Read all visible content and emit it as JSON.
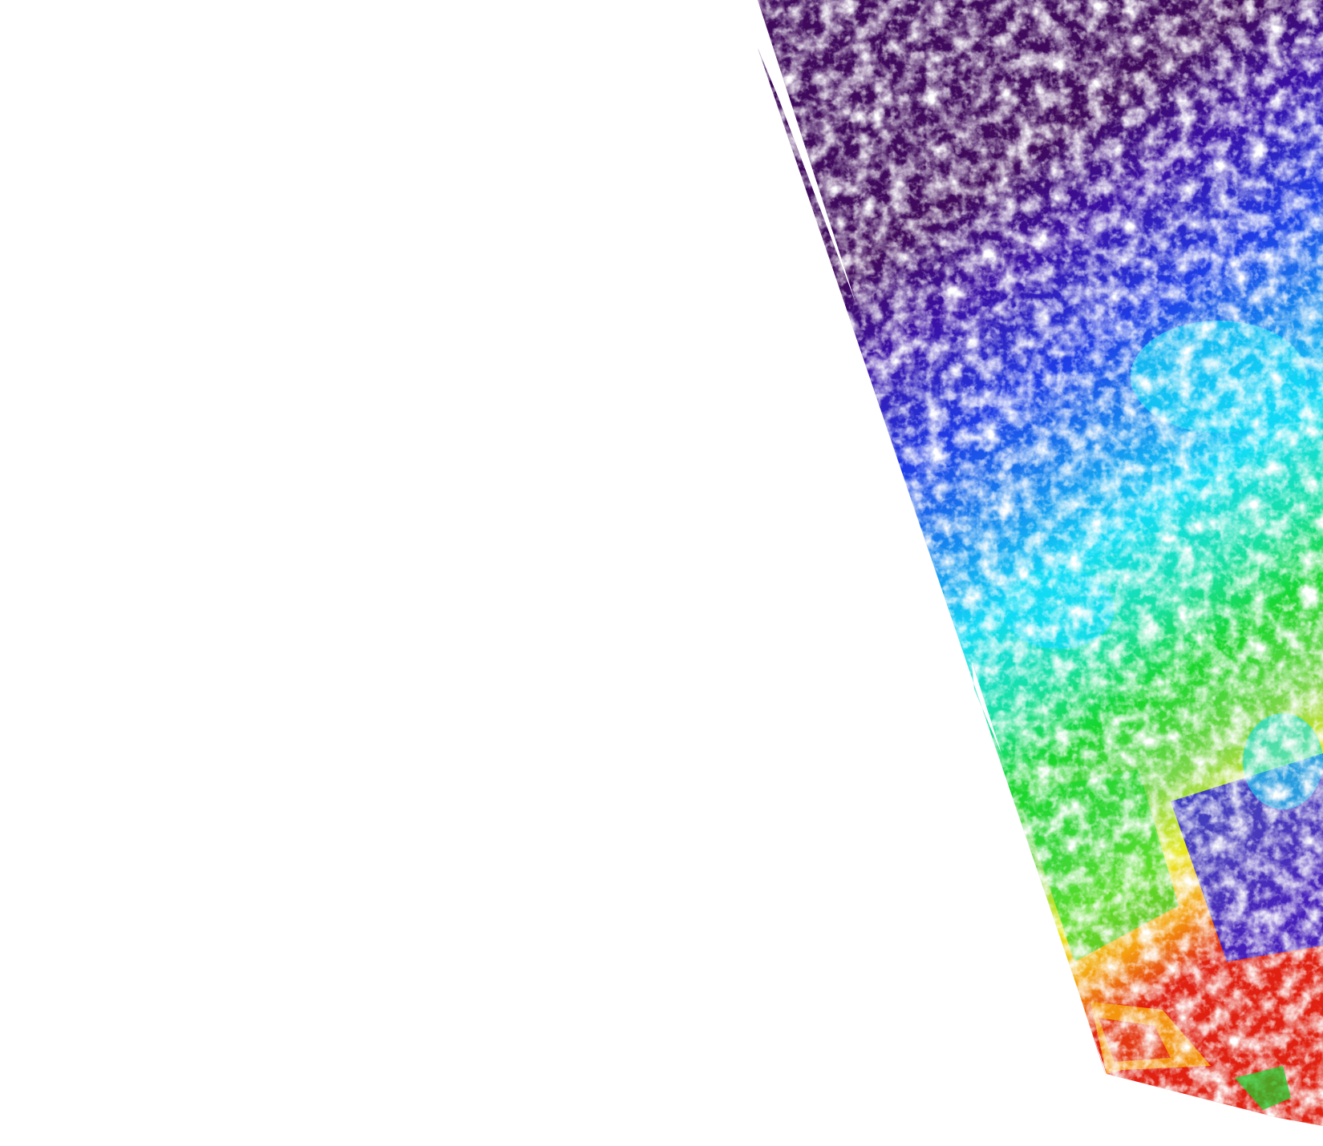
{
  "colors": {
    "background": "#ffffff",
    "no_data": "#ffffff",
    "palette": [
      "#3f0a5c",
      "#3a0fa6",
      "#1e3ce6",
      "#1490f0",
      "#12dcf5",
      "#18e0a0",
      "#16d62c",
      "#7cd64a",
      "#e8ea20",
      "#f5a010",
      "#e02010"
    ]
  },
  "legend": {
    "text": ""
  }
}
